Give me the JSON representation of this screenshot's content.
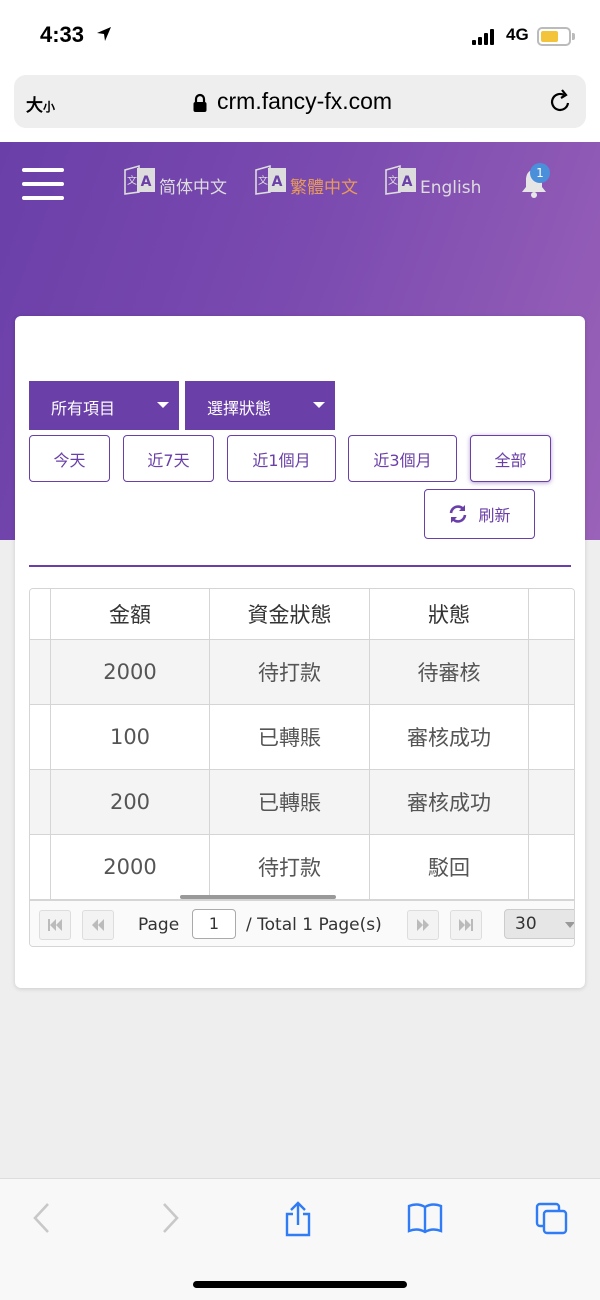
{
  "status": {
    "time": "4:33",
    "network": "4G"
  },
  "browser": {
    "text_size": "大",
    "text_size_small": "小",
    "url": "crm.fancy-fx.com"
  },
  "header": {
    "languages": [
      {
        "label": "简体中文",
        "active": false
      },
      {
        "label": "繁體中文",
        "active": true
      },
      {
        "label": "English",
        "active": false
      }
    ],
    "notification_count": "1"
  },
  "filters": {
    "project_select": "所有項目",
    "status_select": "選擇狀態",
    "range_buttons": [
      "今天",
      "近7天",
      "近1個月",
      "近3個月",
      "全部"
    ],
    "active_range": "全部",
    "refresh_label": "刷新"
  },
  "table": {
    "columns": [
      "金額",
      "資金狀態",
      "狀態"
    ],
    "rows": [
      [
        "2000",
        "待打款",
        "待審核"
      ],
      [
        "100",
        "已轉賬",
        "審核成功"
      ],
      [
        "200",
        "已轉賬",
        "審核成功"
      ],
      [
        "2000",
        "待打款",
        "駁回"
      ]
    ]
  },
  "pager": {
    "page_label": "Page",
    "page_value": "1",
    "total_label": "/ Total 1 Page(s)",
    "page_size": "30"
  },
  "colors": {
    "primary": "#6a3fa8",
    "active_lang": "#e89a5a",
    "badge": "#4a8fd9",
    "ios_blue": "#2f7cf6"
  }
}
